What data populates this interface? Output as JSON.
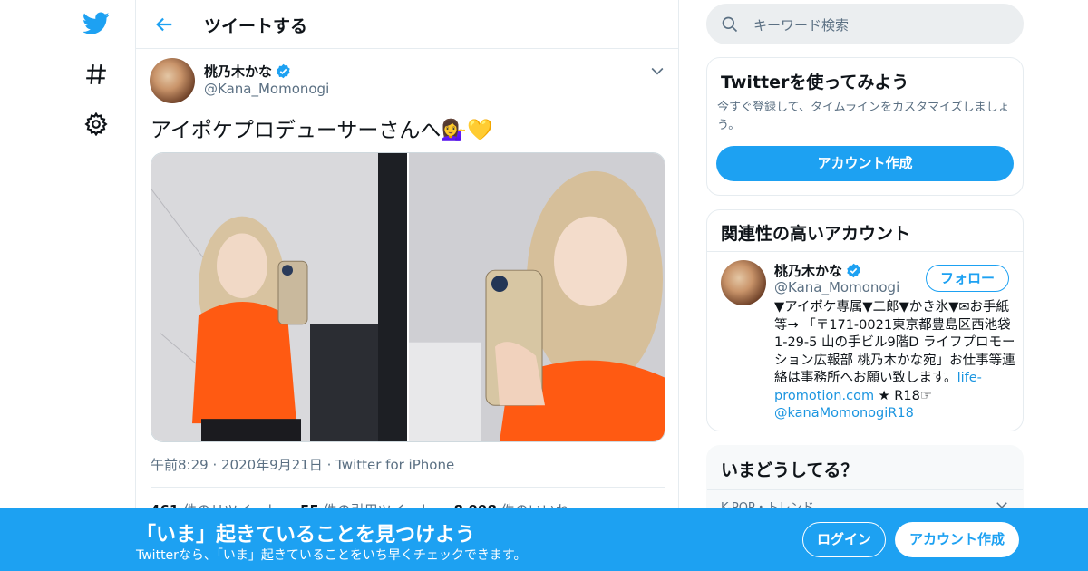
{
  "header": {
    "title": "ツイートする"
  },
  "tweet": {
    "author_name": "桃乃木かな",
    "author_handle": "@Kana_Momonogi",
    "text": "アイポケプロデューサーさんへ💁‍♀️💛",
    "time": "午前8:29",
    "date": "2020年9月21日",
    "source": "Twitter for iPhone",
    "stats": {
      "retweets": "461",
      "retweets_label": "件のリツイート",
      "quotes": "55",
      "quotes_label": "件の引用ツイート",
      "likes": "8,998",
      "likes_label": "件のいいね"
    }
  },
  "search": {
    "placeholder": "キーワード検索"
  },
  "signup_card": {
    "title": "Twitterを使ってみよう",
    "subtitle": "今すぐ登録して、タイムラインをカスタマイズしましょう。",
    "button": "アカウント作成"
  },
  "related": {
    "title": "関連性の高いアカウント",
    "name": "桃乃木かな",
    "handle": "@Kana_Momonogi",
    "follow": "フォロー",
    "bio_text": "▼アイポケ専属▼二郎▼かき氷▼✉お手紙等→ 「〒171-0021東京都豊島区西池袋1-29-5 山の手ビル9階D ライフプロモーション広報部 桃乃木かな宛」お仕事等連絡は事務所へお願い致します。",
    "bio_link": "life-promotion.com",
    "bio_r18": " ★ R18☞",
    "bio_mention": "@kanaMomonogiR18"
  },
  "trends": {
    "title": "いまどうしてる？",
    "first_label": "K-POP・トレンド"
  },
  "banner": {
    "title": "「いま」起きていることを見つけよう",
    "subtitle": "Twitterなら、「いま」起きていることをいち早くチェックできます。",
    "login": "ログイン",
    "signup": "アカウント作成"
  },
  "colors": {
    "accent": "#1da1f2",
    "text": "#0f1419",
    "muted": "#5b7083"
  }
}
